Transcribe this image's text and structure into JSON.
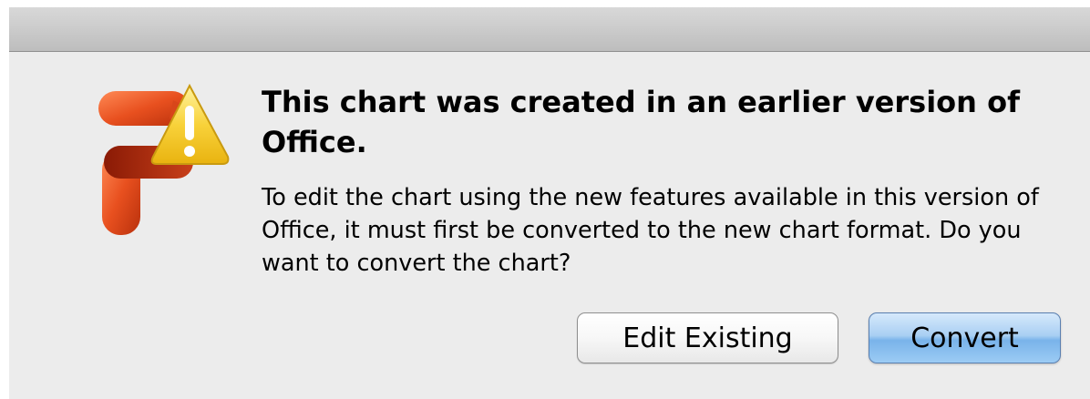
{
  "dialog": {
    "heading": "This chart was created in an earlier version of Office.",
    "body": "To edit the chart using the new features available in this version of Office, it must first be converted to the new chart format. Do you want to convert the chart?",
    "app_icon": "powerpoint-logo-with-warning",
    "buttons": {
      "edit_existing_label": "Edit Existing",
      "convert_label": "Convert"
    },
    "accent_color": "#79b3ea",
    "icon_colors": {
      "logo": "#e8501f",
      "warning": "#f5c518"
    }
  }
}
